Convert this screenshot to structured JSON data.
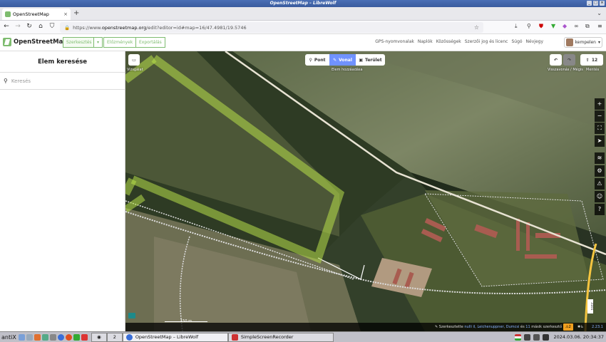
{
  "window": {
    "title": "OpenStreetMap – LibreWolf"
  },
  "tab": {
    "title": "OpenStreetMap",
    "new_tab": "+"
  },
  "url": {
    "prefix": "https://www.",
    "domain": "openstreetmap.org",
    "path": "/edit?editor=id#map=16/47.4981/19.5746"
  },
  "osm": {
    "logo": "OpenStreetMap",
    "edit_label": "Szerkesztés",
    "edit_dropdown": "▾",
    "history_label": "Előzmények",
    "export_label": "Exportálás",
    "links": [
      "GPS-nyomvonalak",
      "Naplók",
      "Közösségek",
      "Szerzői jog és licenc",
      "Súgó",
      "Névjegy"
    ],
    "username": "kempelen"
  },
  "sidebar": {
    "title": "Elem keresése",
    "search_placeholder": "Keresés"
  },
  "map": {
    "view_label": "Vizsgálat",
    "point": "Pont",
    "line": "Vonal",
    "area": "Terület",
    "add_feature": "Elem hozzáadása",
    "undo_label": "Visszavonás / Mégis",
    "save_count": "12",
    "save_label": "Mentés",
    "scale": "150 m",
    "attribution_prefix": "Szerkesztette",
    "attribution_editors": "nulli il, Leichenuppner, Dumcsi",
    "attribution_and": "és",
    "attribution_count": "11",
    "attribution_suffix": "másik szerkesztő",
    "issue_count": "2",
    "road_ref": "3101",
    "version": "2.23.1"
  },
  "taskbar": {
    "start": "antiX",
    "workspace": "2",
    "win1": "OpenStreetMap – LibreWolf",
    "win2": "SimpleScreenRecorder",
    "clock": "2024.03.06. 20:34:37"
  },
  "colors": {
    "osm_green": "#7ebc6f",
    "line_blue": "#7092ff",
    "titlebar": "#3a5c9e"
  }
}
